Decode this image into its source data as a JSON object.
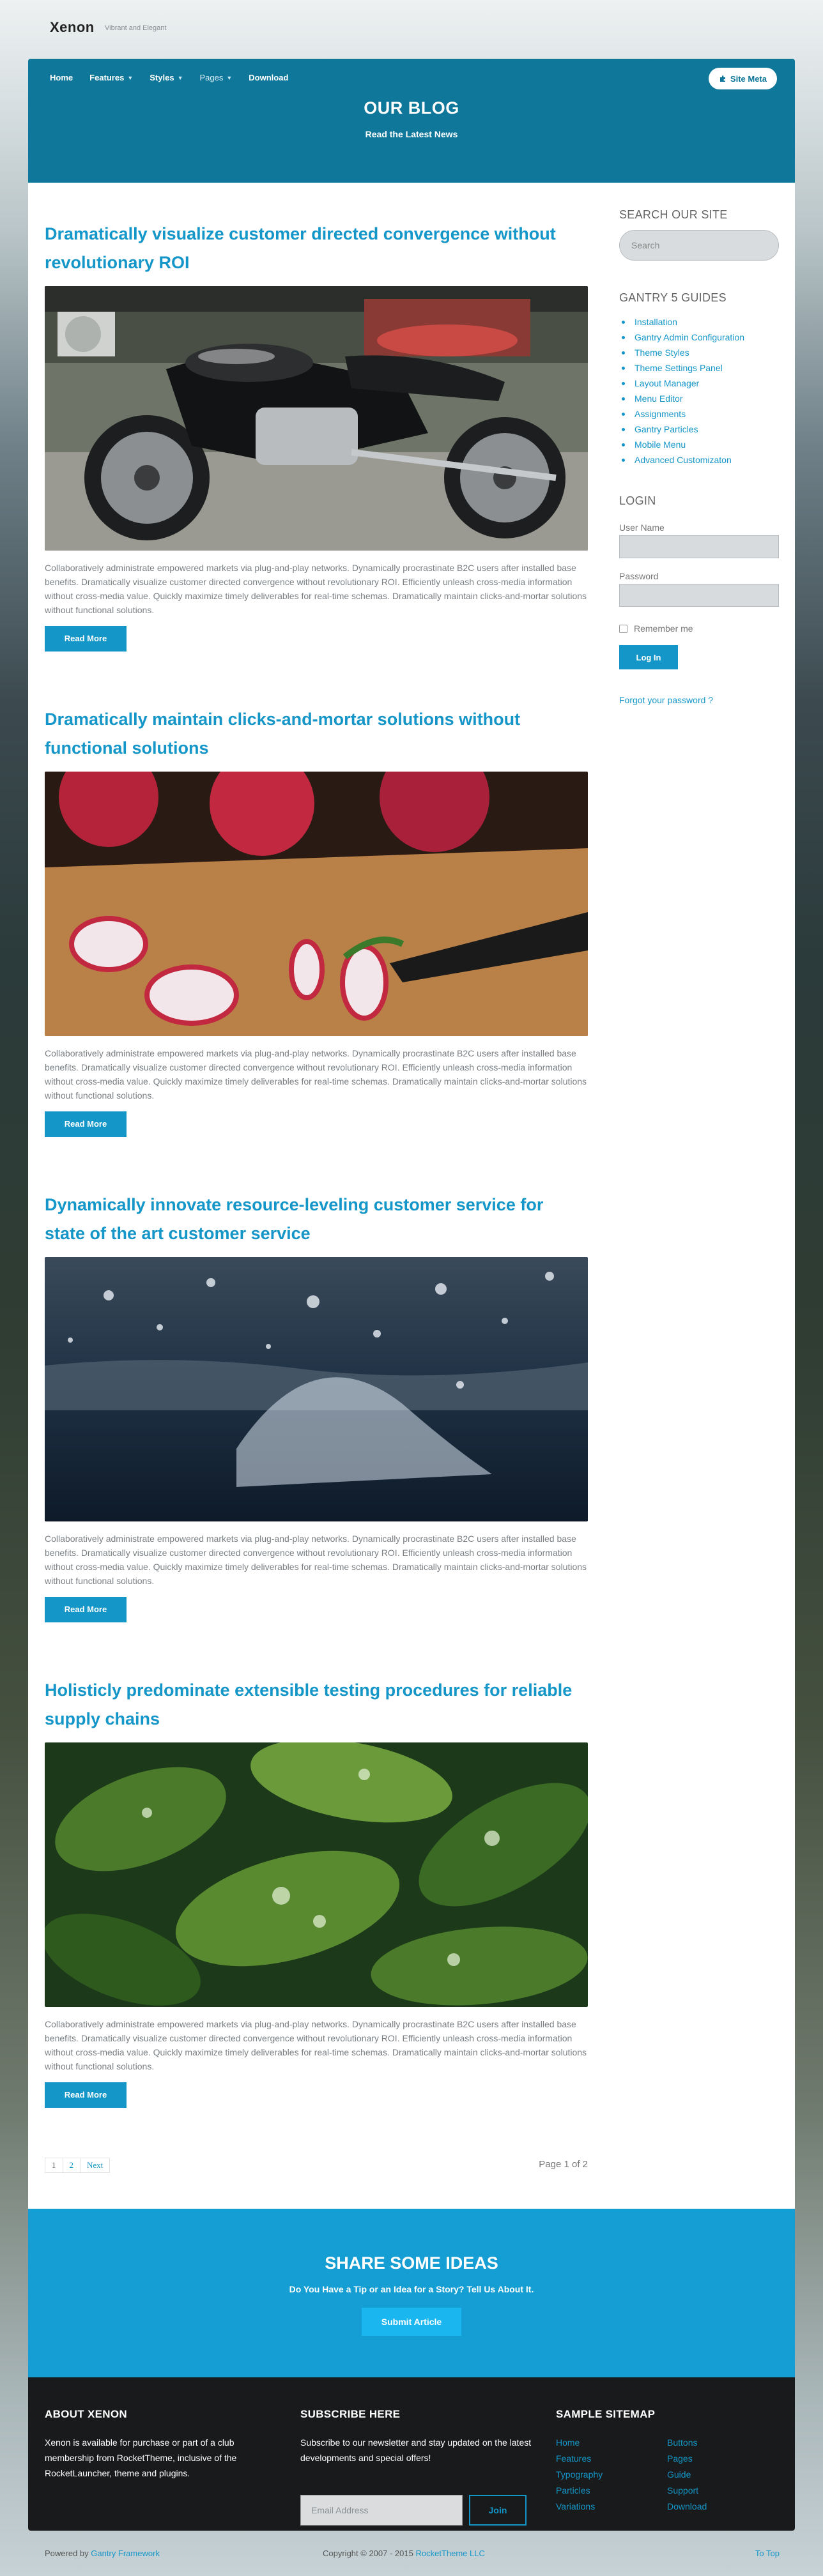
{
  "topbar": {
    "logo": "Xenon",
    "tagline": "Vibrant and Elegant"
  },
  "nav": {
    "items": [
      {
        "label": "Home"
      },
      {
        "label": "Features"
      },
      {
        "label": "Styles"
      },
      {
        "label": "Pages"
      },
      {
        "label": "Download"
      }
    ],
    "site_meta": "Site Meta"
  },
  "header": {
    "title": "OUR BLOG",
    "subtitle": "Read the Latest News"
  },
  "articles": [
    {
      "title": "Dramatically visualize customer directed convergence without revolutionary ROI",
      "image": "motorcycle",
      "text": "Collaboratively administrate empowered markets via plug-and-play networks. Dynamically procrastinate B2C users after installed base benefits. Dramatically visualize customer directed convergence without revolutionary ROI. Efficiently unleash cross-media information without cross-media value. Quickly maximize timely deliverables for real-time schemas. Dramatically maintain clicks-and-mortar solutions without functional solutions.",
      "button": "Read More"
    },
    {
      "title": "Dramatically maintain clicks-and-mortar solutions without functional solutions",
      "image": "radishes",
      "text": "Collaboratively administrate empowered markets via plug-and-play networks. Dynamically procrastinate B2C users after installed base benefits. Dramatically visualize customer directed convergence without revolutionary ROI. Efficiently unleash cross-media information without cross-media value. Quickly maximize timely deliverables for real-time schemas. Dramatically maintain clicks-and-mortar solutions without functional solutions.",
      "button": "Read More"
    },
    {
      "title": "Dynamically innovate resource-leveling customer service for state of the art customer service",
      "image": "water-splash",
      "text": "Collaboratively administrate empowered markets via plug-and-play networks. Dynamically procrastinate B2C users after installed base benefits. Dramatically visualize customer directed convergence without revolutionary ROI. Efficiently unleash cross-media information without cross-media value. Quickly maximize timely deliverables for real-time schemas. Dramatically maintain clicks-and-mortar solutions without functional solutions.",
      "button": "Read More"
    },
    {
      "title": "Holisticly predominate extensible testing procedures for reliable supply chains",
      "image": "leaves-dew",
      "text": "Collaboratively administrate empowered markets via plug-and-play networks. Dynamically procrastinate B2C users after installed base benefits. Dramatically visualize customer directed convergence without revolutionary ROI. Efficiently unleash cross-media information without cross-media value. Quickly maximize timely deliverables for real-time schemas. Dramatically maintain clicks-and-mortar solutions without functional solutions.",
      "button": "Read More"
    }
  ],
  "pagination": {
    "pages": [
      "1",
      "2"
    ],
    "next": "Next",
    "status": "Page 1 of 2"
  },
  "sidebar": {
    "search_heading": "SEARCH OUR SITE",
    "search_placeholder": "Search",
    "guides_heading": "GANTRY 5 GUIDES",
    "guides": [
      "Installation",
      "Gantry Admin Configuration",
      "Theme Styles",
      "Theme Settings Panel",
      "Layout Manager",
      "Menu Editor",
      "Assignments",
      "Gantry Particles",
      "Mobile Menu",
      "Advanced Customizaton"
    ],
    "login_heading": "LOGIN",
    "username_label": "User Name",
    "password_label": "Password",
    "remember_label": "Remember me",
    "login_button": "Log In",
    "forgot_link": "Forgot your password ?"
  },
  "share": {
    "title": "SHARE SOME IDEAS",
    "subtitle": "Do You Have a Tip or an Idea for a Story? Tell Us About It.",
    "button": "Submit Article"
  },
  "footer": {
    "about_heading": "ABOUT XENON",
    "about_text": "Xenon is available for purchase or part of a club membership from RocketTheme, inclusive of the RocketLauncher, theme and plugins.",
    "subscribe_heading": "SUBSCRIBE HERE",
    "subscribe_text": "Subscribe to our newsletter and stay updated on the latest developments and special offers!",
    "email_placeholder": "Email Address",
    "join_button": "Join",
    "sitemap_heading": "SAMPLE SITEMAP",
    "sitemap": [
      "Home",
      "Buttons",
      "Features",
      "Pages",
      "Typography",
      "Guide",
      "Particles",
      "Support",
      "Variations",
      "Download"
    ]
  },
  "bottom": {
    "powered_prefix": "Powered by",
    "powered_link": "Gantry Framework",
    "copyright_prefix": "Copyright © 2007 - 2015",
    "copyright_link": "RocketTheme LLC",
    "to_top": "To Top"
  },
  "colors": {
    "accent": "#1596c8",
    "header_bg": "#0f7799",
    "share_bg": "#149ed3",
    "footer_bg": "#181a1b"
  }
}
